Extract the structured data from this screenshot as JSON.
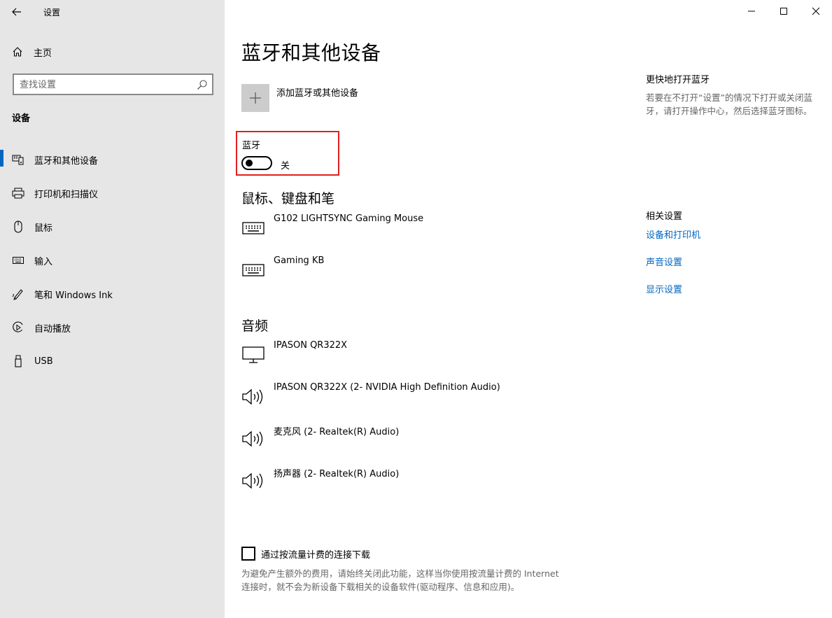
{
  "window": {
    "title": "设置",
    "controls": [
      "minimize",
      "maximize",
      "close"
    ]
  },
  "sidebar": {
    "home_label": "主页",
    "search_placeholder": "查找设置",
    "section_label": "设备",
    "items": [
      {
        "label": "蓝牙和其他设备",
        "icon": "bluetooth-devices-icon",
        "active": true
      },
      {
        "label": "打印机和扫描仪",
        "icon": "printer-icon",
        "active": false
      },
      {
        "label": "鼠标",
        "icon": "mouse-icon",
        "active": false
      },
      {
        "label": "输入",
        "icon": "keyboard-icon",
        "active": false
      },
      {
        "label": "笔和 Windows Ink",
        "icon": "pen-icon",
        "active": false
      },
      {
        "label": "自动播放",
        "icon": "autoplay-icon",
        "active": false
      },
      {
        "label": "USB",
        "icon": "usb-icon",
        "active": false
      }
    ]
  },
  "main": {
    "title": "蓝牙和其他设备",
    "add_device_label": "添加蓝牙或其他设备",
    "bluetooth": {
      "label": "蓝牙",
      "state": "关",
      "on": false
    },
    "mouse_section": {
      "heading": "鼠标、键盘和笔",
      "devices": [
        {
          "name": "G102 LIGHTSYNC Gaming Mouse",
          "icon": "keyboard-icon"
        },
        {
          "name": "Gaming KB",
          "icon": "keyboard-icon"
        }
      ]
    },
    "audio_section": {
      "heading": "音频",
      "devices": [
        {
          "name": "IPASON QR322X",
          "icon": "monitor-icon"
        },
        {
          "name": "IPASON QR322X (2- NVIDIA High Definition Audio)",
          "icon": "speaker-icon"
        },
        {
          "name": "麦克风 (2- Realtek(R) Audio)",
          "icon": "speaker-icon"
        },
        {
          "name": "扬声器 (2- Realtek(R) Audio)",
          "icon": "speaker-icon"
        }
      ]
    },
    "metered": {
      "label": "通过按流量计费的连接下载",
      "checked": false,
      "description": "为避免产生额外的费用，请始终关闭此功能，这样当你使用按流量计费的 Internet 连接时，就不会为新设备下载相关的设备软件(驱动程序、信息和应用)。"
    }
  },
  "right_panel": {
    "quick_title": "更快地打开蓝牙",
    "quick_desc": "若要在不打开“设置”的情况下打开或关闭蓝牙，请打开操作中心，然后选择蓝牙图标。",
    "related_title": "相关设置",
    "links": [
      "设备和打印机",
      "声音设置",
      "显示设置"
    ]
  },
  "colors": {
    "sidebar_bg": "#e6e6e6",
    "accent": "#0067c0",
    "highlight_border": "#e02020",
    "secondary_text": "#666666"
  }
}
